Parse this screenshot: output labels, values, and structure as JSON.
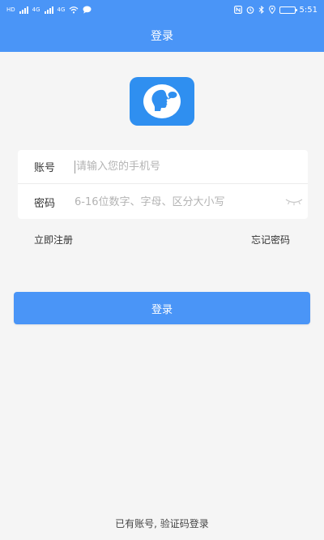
{
  "status_bar": {
    "net_label_1": "HD",
    "net_label_2": "4G",
    "net_label_3": "4G",
    "time": "5:51",
    "battery_level": 0.9
  },
  "header": {
    "title": "登录"
  },
  "form": {
    "account_label": "账号",
    "account_placeholder": "请输入您的手机号",
    "password_label": "密码",
    "password_placeholder": "6-16位数字、字母、区分大小写"
  },
  "links": {
    "register": "立即注册",
    "forgot_password": "忘记密码"
  },
  "login_button": "登录",
  "alt_login": "已有账号, 验证码登录",
  "colors": {
    "primary": "#4a95f7",
    "background": "#f5f5f5",
    "logo": "#2f8ff0"
  },
  "icons": {
    "logo": "speech-bubble-head-icon",
    "eye": "eye-closed-icon"
  }
}
